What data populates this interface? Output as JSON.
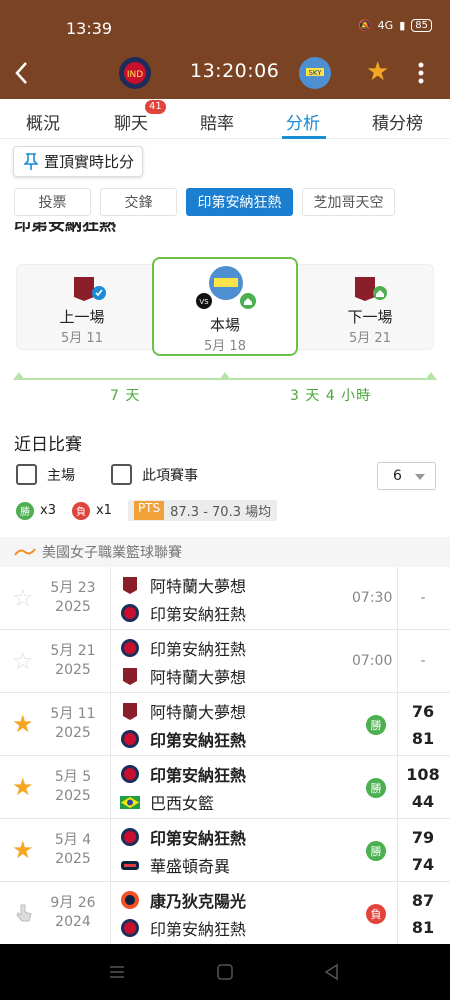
{
  "status": {
    "time": "13:39",
    "battery": "85",
    "network": "4G"
  },
  "header": {
    "clock": "13:20:06"
  },
  "tabs": [
    {
      "label": "概況"
    },
    {
      "label": "聊天",
      "badge": "41"
    },
    {
      "label": "賠率"
    },
    {
      "label": "分析",
      "active": true
    },
    {
      "label": "積分榜"
    }
  ],
  "pin_label": "置頂實時比分",
  "chips": [
    {
      "label": "投票"
    },
    {
      "label": "交鋒"
    },
    {
      "label": "印第安納狂熱",
      "selected": true
    },
    {
      "label": "芝加哥天空"
    }
  ],
  "subtitle": "印第安納狂熱",
  "schedule": {
    "prev": {
      "label": "上一場",
      "date": "5月 11"
    },
    "current": {
      "label": "本場",
      "date": "5月 18",
      "vs": "VS"
    },
    "next": {
      "label": "下一場",
      "date": "5月 21"
    },
    "gap_before": "7 天",
    "gap_after": "3 天 4 小時"
  },
  "recent": {
    "title": "近日比賽",
    "filter_home": "主場",
    "filter_event": "此項賽事",
    "count": "6",
    "wins_icon": "勝",
    "wins": "x3",
    "losses_icon": "負",
    "losses": "x1",
    "pts_label": "PTS",
    "pts_value": "87.3 - 70.3 場均"
  },
  "league_name": "美國女子職業籃球聯賽",
  "matches": [
    {
      "date": "5月 23",
      "year": "2025",
      "team1": "阿特蘭大夢想",
      "team2": "印第安納狂熱",
      "time": "07:30",
      "score1": "-",
      "starred": false
    },
    {
      "date": "5月 21",
      "year": "2025",
      "team1": "印第安納狂熱",
      "team2": "阿特蘭大夢想",
      "time": "07:00",
      "score1": "-",
      "starred": false
    },
    {
      "date": "5月 11",
      "year": "2025",
      "team1": "阿特蘭大夢想",
      "team2": "印第安納狂熱",
      "result": "勝",
      "score1": "76",
      "score2": "81",
      "starred": true
    },
    {
      "date": "5月 5",
      "year": "2025",
      "team1": "印第安納狂熱",
      "team2": "巴西女籃",
      "result": "勝",
      "score1": "108",
      "score2": "44",
      "starred": true
    },
    {
      "date": "5月 4",
      "year": "2025",
      "team1": "印第安納狂熱",
      "team2": "華盛頓奇異",
      "result": "勝",
      "score1": "79",
      "score2": "74",
      "starred": true
    },
    {
      "date": "9月 26",
      "year": "2024",
      "team1": "康乃狄克陽光",
      "team2": "印第安納狂熱",
      "result": "負",
      "score1": "87",
      "score2": "81",
      "starred": false
    }
  ],
  "colors": {
    "header_bg": "#7a4424",
    "accent": "#1a8bd6",
    "win": "#4caf50",
    "loss": "#e0443b",
    "star": "#f5a623",
    "timeline": "#b8e3a6"
  }
}
